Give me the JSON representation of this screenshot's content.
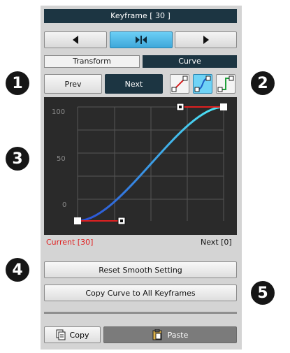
{
  "title": "Keyframe [ 30 ]",
  "nav": {
    "prev_icon": "triangle-left-icon",
    "center_icon": "keyframe-mirror-icon",
    "next_icon": "triangle-right-icon"
  },
  "tabs": [
    {
      "label": "Transform",
      "active": false
    },
    {
      "label": "Curve",
      "active": true
    }
  ],
  "prev_label": "Prev",
  "next_label": "Next",
  "curve_types": [
    "linear-curve-icon",
    "smooth-curve-icon",
    "step-curve-icon"
  ],
  "graph": {
    "y_ticks": [
      "100",
      "50",
      "0"
    ],
    "colors": {
      "start": "#2a4fd6",
      "end": "#4de8f5",
      "handle": "#e02020"
    }
  },
  "current_label": "Current [30]",
  "next_frame_label": "Next [0]",
  "reset_label": "Reset Smooth Setting",
  "copy_curve_label": "Copy Curve to All Keyframes",
  "copy_label": "Copy",
  "paste_label": "Paste",
  "annotations": [
    "1",
    "2",
    "3",
    "4",
    "5"
  ]
}
